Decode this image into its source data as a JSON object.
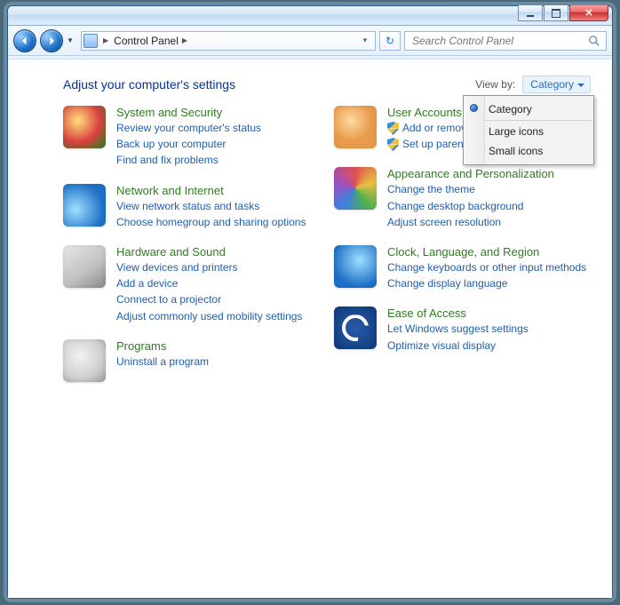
{
  "titlebar": {
    "title": ""
  },
  "nav": {
    "breadcrumb_root": "Control Panel",
    "search_placeholder": "Search Control Panel"
  },
  "header": {
    "page_title": "Adjust your computer's settings",
    "viewby_label": "View by:",
    "viewby_value": "Category"
  },
  "viewby_menu": {
    "items": [
      {
        "label": "Category",
        "selected": true
      },
      {
        "label": "Large icons",
        "selected": false
      },
      {
        "label": "Small icons",
        "selected": false
      }
    ]
  },
  "left_categories": [
    {
      "icon": "security",
      "title": "System and Security",
      "links": [
        {
          "text": "Review your computer's status"
        },
        {
          "text": "Back up your computer"
        },
        {
          "text": "Find and fix problems"
        }
      ]
    },
    {
      "icon": "network",
      "title": "Network and Internet",
      "links": [
        {
          "text": "View network status and tasks"
        },
        {
          "text": "Choose homegroup and sharing options"
        }
      ]
    },
    {
      "icon": "hardware",
      "title": "Hardware and Sound",
      "links": [
        {
          "text": "View devices and printers"
        },
        {
          "text": "Add a device"
        },
        {
          "text": "Connect to a projector"
        },
        {
          "text": "Adjust commonly used mobility settings"
        }
      ]
    },
    {
      "icon": "programs",
      "title": "Programs",
      "links": [
        {
          "text": "Uninstall a program"
        }
      ]
    }
  ],
  "right_categories": [
    {
      "icon": "users",
      "title": "User Accounts and Family Safety",
      "links": [
        {
          "text": "Add or remove user accounts",
          "shield": true
        },
        {
          "text": "Set up parental controls for any user",
          "shield": true
        }
      ]
    },
    {
      "icon": "appearance",
      "title": "Appearance and Personalization",
      "links": [
        {
          "text": "Change the theme"
        },
        {
          "text": "Change desktop background"
        },
        {
          "text": "Adjust screen resolution"
        }
      ]
    },
    {
      "icon": "clock",
      "title": "Clock, Language, and Region",
      "links": [
        {
          "text": "Change keyboards or other input methods"
        },
        {
          "text": "Change display language"
        }
      ]
    },
    {
      "icon": "ease",
      "title": "Ease of Access",
      "links": [
        {
          "text": "Let Windows suggest settings"
        },
        {
          "text": "Optimize visual display"
        }
      ]
    }
  ]
}
